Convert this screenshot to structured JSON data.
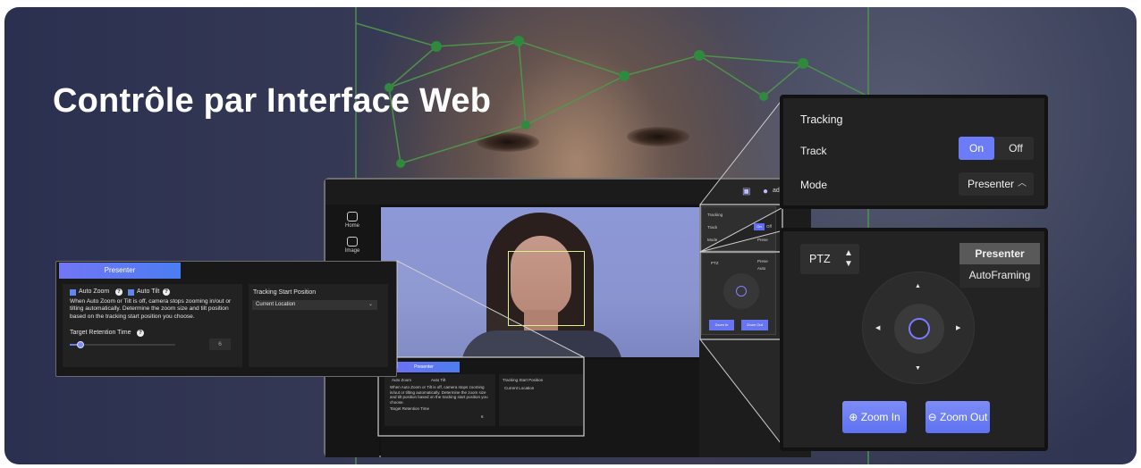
{
  "headline": "Contrôle par Interface Web",
  "colors": {
    "accent": "#6b7cf6",
    "background": "#2f3552",
    "panel": "#222222",
    "face_box": "#d9f28a"
  },
  "main_screen": {
    "topbar": {
      "user_icon": "user-icon",
      "user_label": "admin"
    },
    "sidebar": [
      {
        "label": "Home",
        "icon": "home-icon"
      },
      {
        "label": "Image",
        "icon": "image-icon"
      }
    ],
    "mini_tracking": {
      "title": "Tracking",
      "track_label": "Track",
      "on": "On",
      "off": "Off",
      "mode_label": "Mode",
      "mode_value": "Prese"
    },
    "mini_ptz": {
      "label": "PTZ",
      "preset": "Prese",
      "auto": "Auto",
      "zoom_in": "Zoom In",
      "zoom_out": "Zoom Out"
    },
    "mini_presenter": {
      "tab": "Presenter",
      "auto_zoom": "Auto Zoom",
      "auto_tilt": "Auto Tilt",
      "desc": "When Auto Zoom or Tilt is off, camera stops zooming in/out or tilting automatically. Determine the zoom size and tilt position based on the tracking start position you choose.",
      "retention": "Target Retention Time",
      "value": "6",
      "start_pos": "Tracking Start Position",
      "start_value": "Current Location"
    }
  },
  "tracking_card": {
    "title": "Tracking",
    "track_label": "Track",
    "on_label": "On",
    "off_label": "Off",
    "track_state": "On",
    "mode_label": "Mode",
    "mode_value": "Presenter"
  },
  "ptz_card": {
    "mode_label": "PTZ",
    "options": [
      "Presenter",
      "AutoFraming"
    ],
    "selected_option": "Presenter",
    "zoom_in": "Zoom In",
    "zoom_out": "Zoom Out"
  },
  "presenter_card": {
    "tab_label": "Presenter",
    "auto_zoom": "Auto Zoom",
    "auto_tilt": "Auto Tilt",
    "description": "When Auto Zoom or Tilt is off, camera stops zooming in/out or tilting automatically. Determine the zoom size and tilt position based on the tracking start position you choose.",
    "retention_label": "Target Retention Time",
    "retention_value": "6",
    "retention_fraction": 0.1,
    "start_position_label": "Tracking Start Position",
    "start_position_value": "Current Location"
  }
}
